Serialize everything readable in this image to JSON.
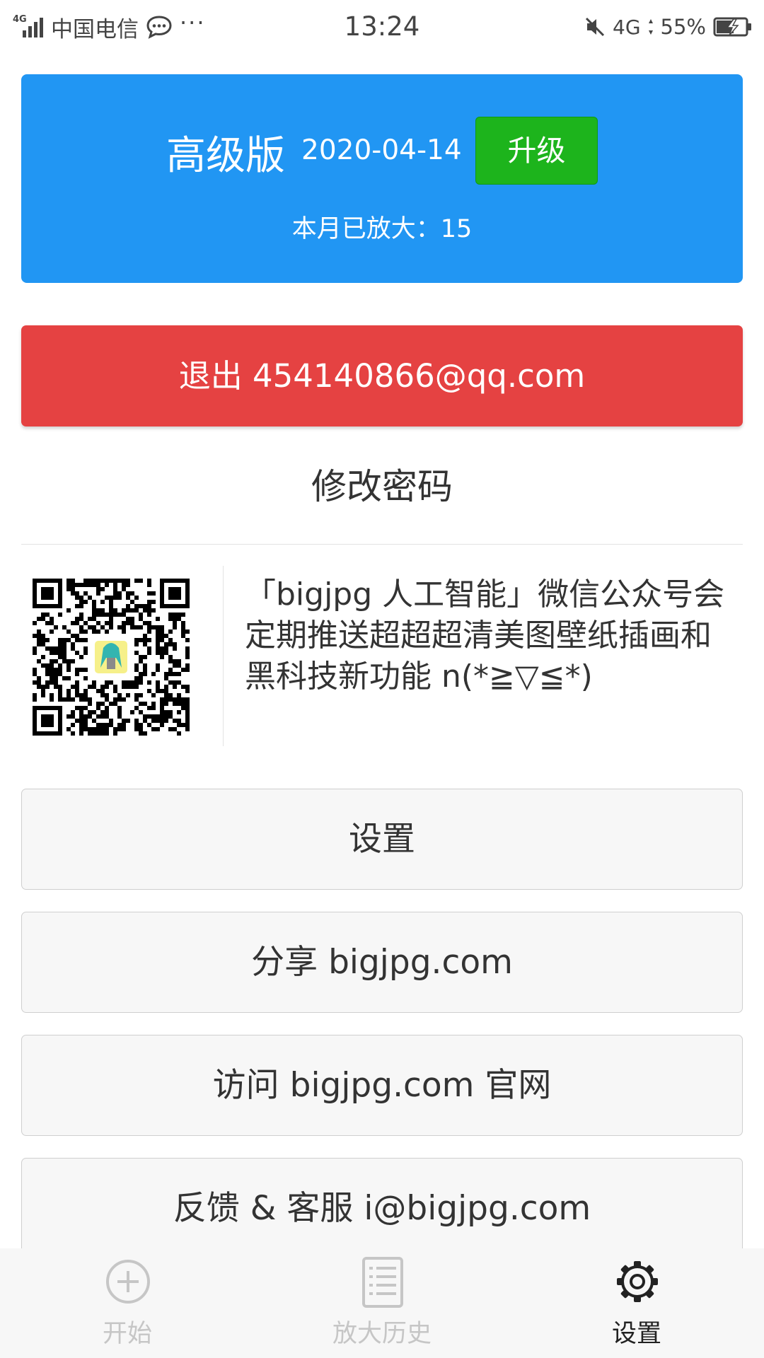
{
  "status_bar": {
    "network_small": "4G",
    "carrier": "中国电信",
    "more": "···",
    "time": "13:24",
    "network": "4G",
    "battery_percent": "55%"
  },
  "account": {
    "plan_name": "高级版",
    "expiry_date": "2020-04-14",
    "upgrade_label": "升级",
    "monthly_count_label": "本月已放大：15"
  },
  "logout_label": "退出 454140866@qq.com",
  "change_password_label": "修改密码",
  "promo": {
    "text": "「bigjpg 人工智能」微信公众号会定期推送超超超清美图壁纸插画和黑科技新功能 n(*≧▽≦*)"
  },
  "menu": {
    "settings_label": "设置",
    "share_label": "分享 bigjpg.com",
    "visit_label": "访问 bigjpg.com 官网",
    "feedback_label": "反馈 & 客服 i@bigjpg.com"
  },
  "tabs": [
    {
      "label": "开始",
      "icon": "plus-circle-icon",
      "active": false
    },
    {
      "label": "放大历史",
      "icon": "list-icon",
      "active": false
    },
    {
      "label": "设置",
      "icon": "gear-icon",
      "active": true
    }
  ],
  "colors": {
    "card_blue": "#2196f3",
    "upgrade_green": "#1db41c",
    "logout_red": "#e54242",
    "button_gray": "#f7f7f7"
  }
}
